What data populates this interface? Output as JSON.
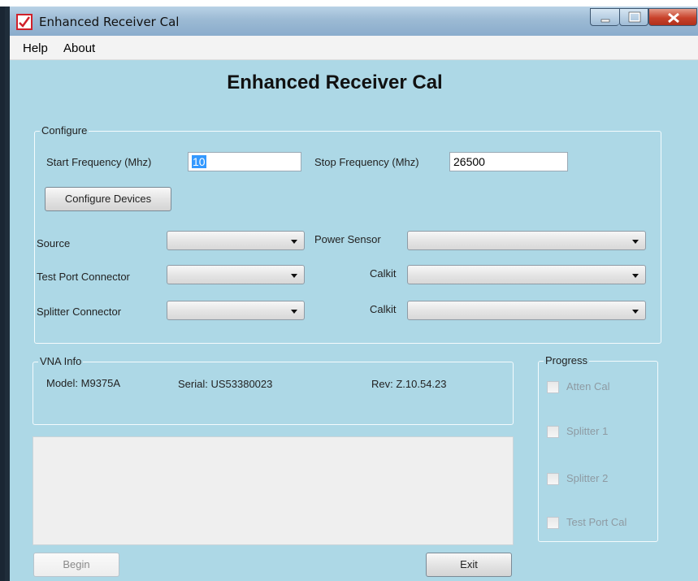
{
  "window": {
    "title": "Enhanced Receiver Cal",
    "controls": [
      "minimize-icon",
      "maximize-icon",
      "close-icon"
    ]
  },
  "menu": [
    "Help",
    "About"
  ],
  "heading": "Enhanced Receiver Cal",
  "configure": {
    "title": "Configure",
    "start_label": "Start Frequency (Mhz)",
    "start_value": "10",
    "stop_label": "Stop Frequency (Mhz)",
    "stop_value": "26500",
    "configure_button": "Configure Devices",
    "source_label": "Source",
    "power_sensor_label": "Power Sensor",
    "test_port_label": "Test Port Connector",
    "calkit_label_1": "Calkit",
    "splitter_label": "Splitter Connector",
    "calkit_label_2": "Calkit"
  },
  "vna": {
    "title": "VNA Info",
    "model": "Model: M9375A",
    "serial": "Serial: US53380023",
    "rev": "Rev: Z.10.54.23"
  },
  "progress": {
    "title": "Progress",
    "items": [
      "Atten Cal",
      "Splitter 1",
      "Splitter 2",
      "Test Port Cal"
    ]
  },
  "buttons": {
    "begin": "Begin",
    "exit": "Exit"
  },
  "colors": {
    "client_bg": "#add8e6",
    "titlebar": "#9cbad4",
    "close_button": "#c8422b"
  }
}
